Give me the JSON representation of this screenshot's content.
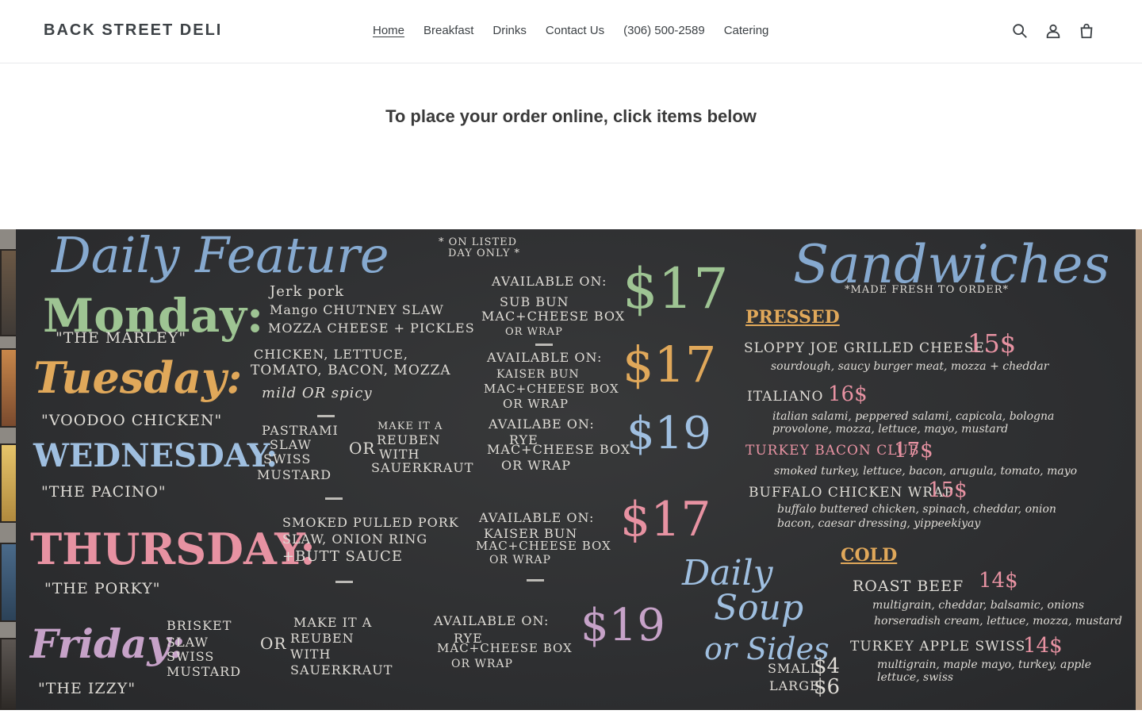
{
  "header": {
    "logo": "BACK STREET DELI",
    "nav": [
      {
        "label": "Home",
        "active": true
      },
      {
        "label": "Breakfast",
        "active": false
      },
      {
        "label": "Drinks",
        "active": false
      },
      {
        "label": "Contact Us",
        "active": false
      },
      {
        "label": "(306) 500-2589",
        "active": false
      },
      {
        "label": "Catering",
        "active": false
      }
    ],
    "icons": [
      "search-icon",
      "account-icon",
      "cart-icon"
    ]
  },
  "main": {
    "heading": "To place your order online, click items below"
  },
  "chalkboard": {
    "feature_title": "Daily Feature",
    "feature_note_1": "* ON LISTED",
    "feature_note_2": "DAY ONLY *",
    "days": [
      {
        "day": "Monday:",
        "nickname": "\"THE MARLEY\"",
        "items": [
          "Jerk pork",
          "Mango CHUTNEY SLAW",
          "MOZZA CHEESE + PICKLES"
        ],
        "available_title": "AVAILABLE ON:",
        "available": [
          "SUB BUN",
          "MAC+CHEESE BOX",
          "OR WRAP"
        ],
        "price": "$17"
      },
      {
        "day": "Tuesday:",
        "nickname": "\"VOODOO CHICKEN\"",
        "items": [
          "CHICKEN, LETTUCE,",
          "TOMATO, BACON, MOZZA",
          "mild OR spicy"
        ],
        "available_title": "AVAILABLE ON:",
        "available": [
          "KAISER BUN",
          "MAC+CHEESE BOX",
          "OR WRAP"
        ],
        "price": "$17"
      },
      {
        "day": "WEDNESDAY:",
        "nickname": "\"THE PACINO\"",
        "items": [
          "PASTRAMI",
          "SLAW",
          "SWISS",
          "MUSTARD"
        ],
        "alt_or": "OR",
        "alt": [
          "MAKE IT A",
          "REUBEN",
          "WITH",
          "SAUERKRAUT"
        ],
        "available_title": "AVAILABE ON:",
        "available": [
          "RYE",
          "MAC+CHEESE BOX",
          "OR WRAP"
        ],
        "price": "$19"
      },
      {
        "day": "THURSDAY:",
        "nickname": "\"THE PORKY\"",
        "items": [
          "SMOKED PULLED PORK",
          "SLAW, ONION RING",
          "+BUTT SAUCE"
        ],
        "available_title": "AVAILABLE ON:",
        "available": [
          "KAISER BUN",
          "MAC+CHEESE BOX",
          "OR WRAP"
        ],
        "price": "$17"
      },
      {
        "day": "Friday:",
        "nickname": "\"THE IZZY\"",
        "items": [
          "BRISKET",
          "SLAW",
          "SWISS",
          "MUSTARD"
        ],
        "alt_or": "OR",
        "alt": [
          "MAKE IT A",
          "REUBEN",
          "WITH",
          "SAUERKRAUT"
        ],
        "available_title": "AVAILABLE ON:",
        "available": [
          "RYE",
          "MAC+CHEESE BOX",
          "OR WRAP"
        ],
        "price": "$19"
      }
    ],
    "sandwiches_title": "Sandwiches",
    "sandwiches_note": "*MADE FRESH TO ORDER*",
    "pressed_label": "PRESSED",
    "pressed": [
      {
        "name": "SLOPPY JOE GRILLED CHEESE",
        "price": "15$",
        "desc": "sourdough, saucy burger meat, mozza + cheddar"
      },
      {
        "name": "ITALIANO",
        "price": "16$",
        "desc": "italian salami, peppered salami, capicola, bologna",
        "desc2": "provolone, mozza, lettuce, mayo, mustard"
      },
      {
        "name": "TURKEY BACON CLUB",
        "price": "17$",
        "desc": "smoked turkey, lettuce, bacon, arugula, tomato, mayo"
      },
      {
        "name": "BUFFALO CHICKEN WRAP",
        "price": "15$",
        "desc": "buffalo buttered chicken, spinach, cheddar, onion",
        "desc2": "bacon, caesar dressing, yippeekiyay"
      }
    ],
    "cold_label": "COLD",
    "cold": [
      {
        "name": "ROAST BEEF",
        "price": "14$",
        "desc": "multigrain, cheddar, balsamic, onions",
        "desc2": "horseradish cream, lettuce, mozza, mustard"
      },
      {
        "name": "TURKEY APPLE SWISS",
        "price": "14$",
        "desc": "multigrain, maple mayo, turkey, apple",
        "desc2": "lettuce, swiss"
      }
    ],
    "soup_title_1": "Daily",
    "soup_title_2": "Soup",
    "soup_title_3": "or Sides",
    "soup_small": "SMALL",
    "soup_small_price": "$4",
    "soup_large": "LARGE",
    "soup_large_price": "$6"
  }
}
